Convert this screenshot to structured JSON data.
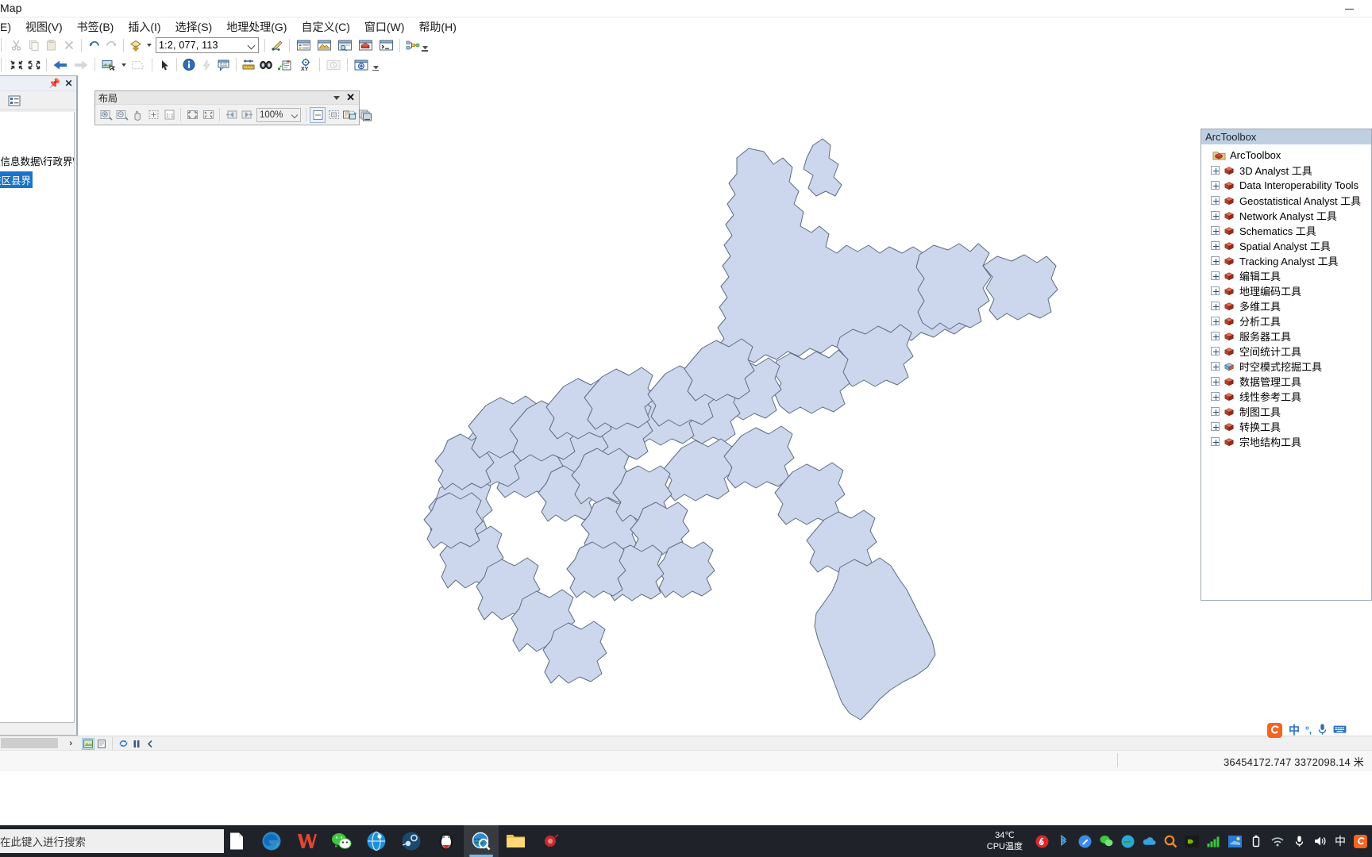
{
  "window": {
    "title": "Map",
    "minimize_label": "minimize"
  },
  "menu": {
    "items": [
      {
        "label": "E)",
        "name": "menu-file"
      },
      {
        "label": "视图(V)",
        "name": "menu-view"
      },
      {
        "label": "书签(B)",
        "name": "menu-bookmarks"
      },
      {
        "label": "插入(I)",
        "name": "menu-insert"
      },
      {
        "label": "选择(S)",
        "name": "menu-selection"
      },
      {
        "label": "地理处理(G)",
        "name": "menu-geoprocessing"
      },
      {
        "label": "自定义(C)",
        "name": "menu-customize"
      },
      {
        "label": "窗口(W)",
        "name": "menu-window"
      },
      {
        "label": "帮助(H)",
        "name": "menu-help"
      }
    ]
  },
  "standard_toolbar": {
    "scale_value": "1:2, 077, 113",
    "buttons": [
      "new-map-button",
      "open-button",
      "save-button",
      "print-button",
      "cut-button",
      "copy-button",
      "paste-button",
      "delete-button",
      "undo-button",
      "redo-button",
      "add-data-button",
      "editor-toolbar-button",
      "table-of-contents-button",
      "catalog-button",
      "search-button",
      "arctoolbox-button",
      "python-window-button",
      "model-builder-button"
    ]
  },
  "tools_toolbar": {
    "buttons": [
      "zoom-in-fixed-button",
      "zoom-out-fixed-button",
      "previous-extent-button",
      "next-extent-button",
      "pan-button",
      "select-features-button",
      "clear-selection-button",
      "select-elements-button",
      "identify-button",
      "hyperlink-button",
      "html-popup-button",
      "measure-button",
      "find-button",
      "find-route-button",
      "go-to-xy-button",
      "time-slider-button",
      "create-viewer-window-button"
    ]
  },
  "toc": {
    "pin_icon": "pin-icon",
    "close_icon": "close-icon",
    "list_by_drawing_order_icon": "list-by-drawing-order-icon",
    "path_text": "理信息数据\\行政界\\",
    "selected_layer": "庆区县界",
    "scroll_right_arrow": "›"
  },
  "layout_toolbar": {
    "title": "布局",
    "zoom_value": "100%",
    "collapse_icon": "chevron-down-icon",
    "close_icon": "close-icon",
    "buttons": [
      "zoom-in-button",
      "zoom-out-button",
      "pan-button",
      "zoom-whole-page-button",
      "zoom-100-percent-button",
      "fixed-zoom-in-button",
      "fixed-zoom-out-button",
      "go-back-extent-button",
      "go-forward-extent-button",
      "toggle-draft-mode-button",
      "focus-data-frame-button",
      "change-layout-button",
      "data-driven-pages-button"
    ]
  },
  "arctoolbox": {
    "caption": "ArcToolbox",
    "root_label": "ArcToolbox",
    "items": [
      {
        "label": "3D Analyst 工具"
      },
      {
        "label": "Data Interoperability Tools"
      },
      {
        "label": "Geostatistical Analyst 工具"
      },
      {
        "label": "Network Analyst 工具"
      },
      {
        "label": "Schematics 工具"
      },
      {
        "label": "Spatial Analyst 工具"
      },
      {
        "label": "Tracking Analyst 工具"
      },
      {
        "label": "编辑工具"
      },
      {
        "label": "地理编码工具"
      },
      {
        "label": "多维工具"
      },
      {
        "label": "分析工具"
      },
      {
        "label": "服务器工具"
      },
      {
        "label": "空间统计工具"
      },
      {
        "label": "时空模式挖掘工具"
      },
      {
        "label": "数据管理工具"
      },
      {
        "label": "线性参考工具"
      },
      {
        "label": "制图工具"
      },
      {
        "label": "转换工具"
      },
      {
        "label": "宗地结构工具"
      }
    ]
  },
  "status": {
    "coordinates": "36454172.747  3372098.14 米",
    "view_buttons": [
      "data-view-button",
      "layout-view-button",
      "refresh-button",
      "pause-button",
      "back-button"
    ]
  },
  "ime": {
    "logo": "sogou-logo-icon",
    "mode": "中",
    "punctuation": "°,",
    "voice_icon": "microphone-icon",
    "keyboard_icon": "keyboard-icon"
  },
  "taskbar": {
    "search_placeholder": "在此键入进行搜索",
    "apps": [
      {
        "name": "taskbar-app-notepad",
        "active": false
      },
      {
        "name": "taskbar-app-edge",
        "active": false
      },
      {
        "name": "taskbar-app-wps",
        "active": false
      },
      {
        "name": "taskbar-app-wechat",
        "active": false
      },
      {
        "name": "taskbar-app-browser",
        "active": false
      },
      {
        "name": "taskbar-app-steam",
        "active": false
      },
      {
        "name": "taskbar-app-qq",
        "active": false
      },
      {
        "name": "taskbar-app-arcmap",
        "active": true
      },
      {
        "name": "taskbar-app-explorer",
        "active": false
      },
      {
        "name": "taskbar-app-recorder",
        "active": false
      }
    ],
    "cpu_temp_value": "34℃",
    "cpu_temp_label": "CPU温度",
    "tray_icons": [
      "netease-music-icon",
      "bluetooth-icon",
      "tool-icon",
      "wechat-icon",
      "browser-icon",
      "onedrive-icon",
      "search-icon",
      "nvidia-icon",
      "signal-icon",
      "weather-icon",
      "usb-icon",
      "wifi-icon",
      "microphone-icon",
      "volume-icon"
    ],
    "tray_text": "中"
  },
  "map": {
    "layer_name": "庆区县界",
    "fill_color": "#ccd6ec",
    "stroke_color": "#5d6b80",
    "background": "#ffffff"
  }
}
